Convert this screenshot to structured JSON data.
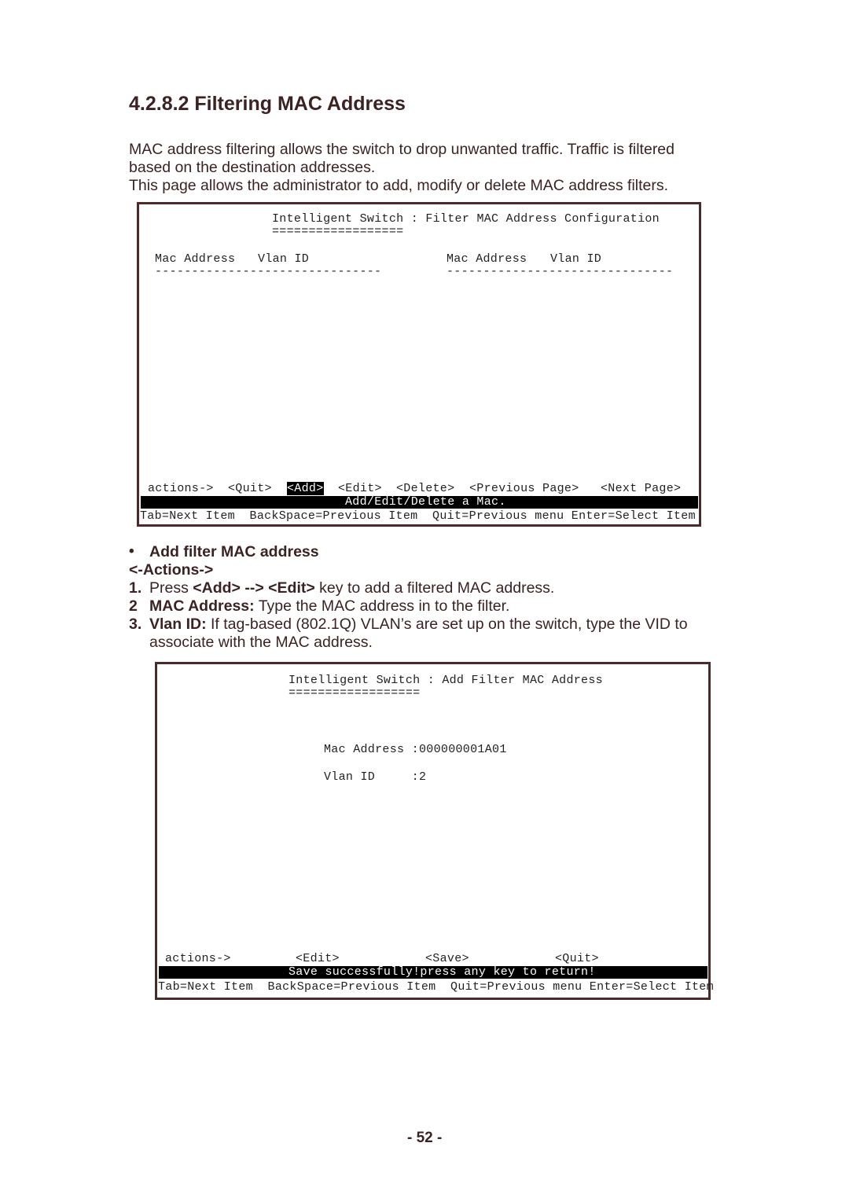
{
  "heading": "4.2.8.2 Filtering MAC Address",
  "intro": [
    "MAC address filtering allows the switch to drop unwanted traffic. Traffic is filtered",
    "based on the destination addresses.",
    "This page allows the administrator to add, modify or delete MAC address filters."
  ],
  "screen1": {
    "title": "Intelligent Switch : Filter MAC Address Configuration",
    "underline": "==================",
    "col_mac": "Mac Address",
    "col_vlan": "Vlan ID",
    "col_mac2": "Mac Address",
    "col_vlan2": "Vlan ID",
    "dashes": "-------------------------------",
    "actions_label": "actions->",
    "actions": [
      "<Quit>",
      "<Add>",
      "<Edit>",
      "<Delete>",
      "<Previous Page>",
      "<Next Page>"
    ],
    "status": "Add/Edit/Delete a Mac.",
    "help": "Tab=Next Item  BackSpace=Previous Item  Quit=Previous menu Enter=Select Item"
  },
  "section": {
    "bullet_title": "Add filter MAC address",
    "actions_label": "<-Actions->",
    "steps": [
      {
        "num": "1.",
        "pre": "Press ",
        "b1": "<Add> --> <Edit>",
        "post": " key to add a filtered MAC address."
      },
      {
        "num": "2",
        "b1": "MAC Address:",
        "post": " Type the MAC address in to the filter."
      },
      {
        "num": "3.",
        "b1": "Vlan ID:",
        "post": " If tag-based (802.1Q) VLAN’s are set up on the switch, type the VID to",
        "post2": "associate with the MAC address."
      }
    ]
  },
  "screen2": {
    "title": "Intelligent Switch : Add Filter MAC Address",
    "underline": "==================",
    "mac_label": "Mac Address :",
    "mac_value": "000000001A01",
    "vlan_label": "Vlan ID     :",
    "vlan_value": "2",
    "actions_label": "actions->",
    "actions": [
      "<Edit>",
      "<Save>",
      "<Quit>"
    ],
    "status": "Save successfully!press any key to return!",
    "help": "Tab=Next Item  BackSpace=Previous Item  Quit=Previous menu Enter=Select Item"
  },
  "page_number": "- 52 -"
}
